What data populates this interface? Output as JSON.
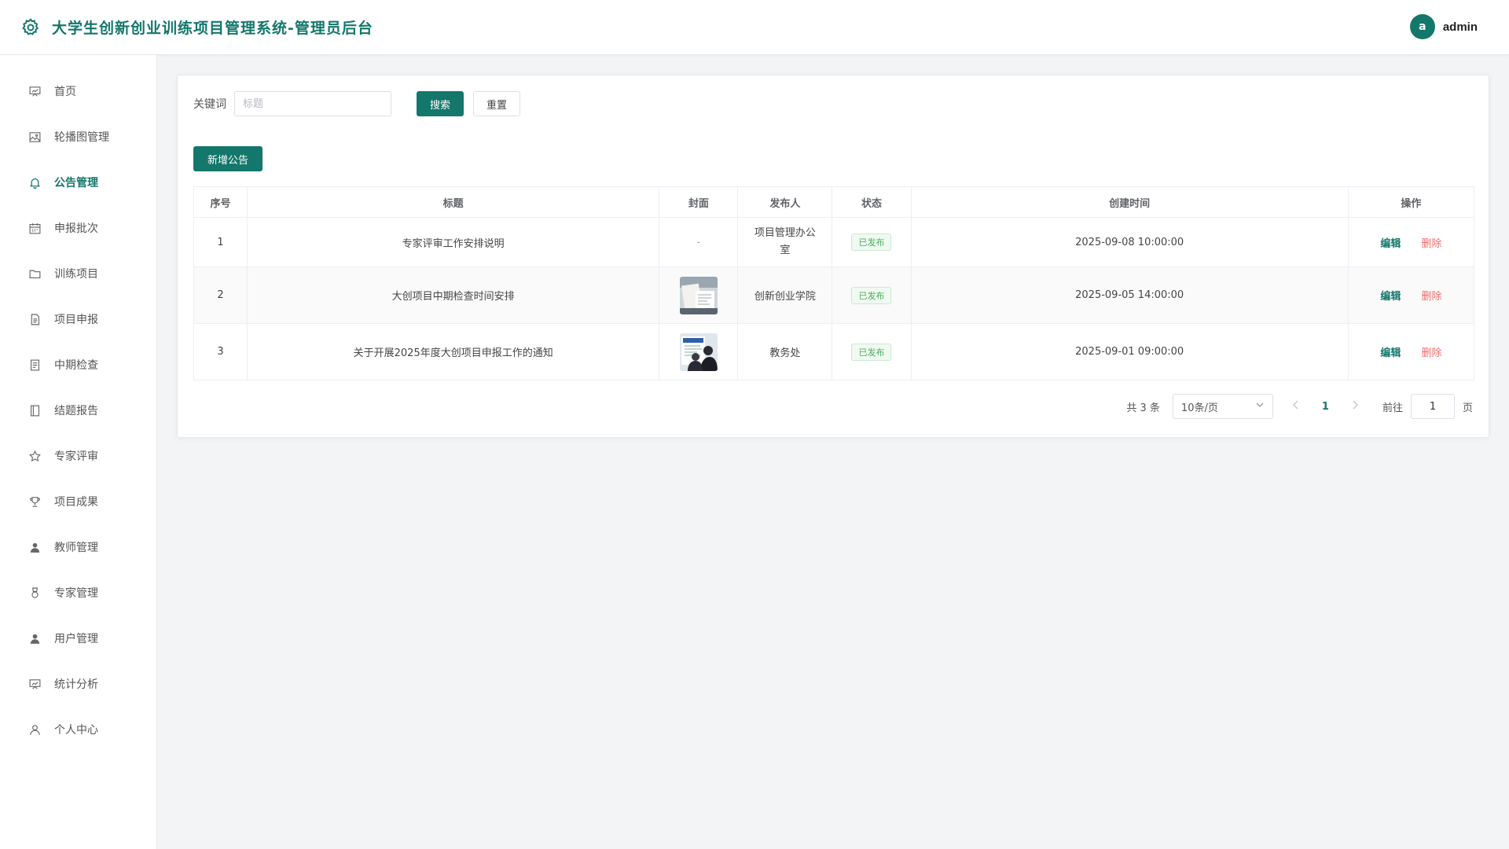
{
  "app": {
    "title": "大学生创新创业训练项目管理系统-管理员后台"
  },
  "user": {
    "avatar_letter": "a",
    "name": "admin"
  },
  "colors": {
    "brand": "#13776b",
    "danger": "#f26a6a",
    "success": "#4cae5b"
  },
  "sidebar": {
    "items": [
      {
        "label": "首页",
        "icon": "dashboard-icon"
      },
      {
        "label": "轮播图管理",
        "icon": "image-icon"
      },
      {
        "label": "公告管理",
        "icon": "bell-icon",
        "active": true
      },
      {
        "label": "申报批次",
        "icon": "calendar-icon"
      },
      {
        "label": "训练项目",
        "icon": "folder-icon"
      },
      {
        "label": "项目申报",
        "icon": "document-icon"
      },
      {
        "label": "中期检查",
        "icon": "checklist-icon"
      },
      {
        "label": "结题报告",
        "icon": "book-icon"
      },
      {
        "label": "专家评审",
        "icon": "star-icon"
      },
      {
        "label": "项目成果",
        "icon": "trophy-icon"
      },
      {
        "label": "教师管理",
        "icon": "user-filled-icon"
      },
      {
        "label": "专家管理",
        "icon": "medal-icon"
      },
      {
        "label": "用户管理",
        "icon": "user-filled-icon"
      },
      {
        "label": "统计分析",
        "icon": "chart-board-icon"
      },
      {
        "label": "个人中心",
        "icon": "user-outline-icon"
      }
    ]
  },
  "search": {
    "label": "关键词",
    "placeholder": "标题",
    "value": "",
    "search_button": "搜索",
    "reset_button": "重置"
  },
  "toolbar": {
    "add_button": "新增公告"
  },
  "table": {
    "columns": [
      "序号",
      "标题",
      "封面",
      "发布人",
      "状态",
      "创建时间",
      "操作"
    ],
    "rows": [
      {
        "index": "1",
        "title": "专家评审工作安排说明",
        "cover": "-",
        "publisher": "项目管理办公室",
        "status": "已发布",
        "created": "2025-09-08 10:00:00"
      },
      {
        "index": "2",
        "title": "大创项目中期检查时间安排",
        "cover": "thumbnail",
        "publisher": "创新创业学院",
        "status": "已发布",
        "created": "2025-09-05 14:00:00"
      },
      {
        "index": "3",
        "title": "关于开展2025年度大创项目申报工作的通知",
        "cover": "thumbnail",
        "publisher": "教务处",
        "status": "已发布",
        "created": "2025-09-01 09:00:00"
      }
    ],
    "edit_label": "编辑",
    "delete_label": "删除"
  },
  "pagination": {
    "total_text": "共 3 条",
    "page_size": "10条/页",
    "current_page": "1",
    "goto_label": "前往",
    "goto_value": "1",
    "page_unit": "页"
  }
}
